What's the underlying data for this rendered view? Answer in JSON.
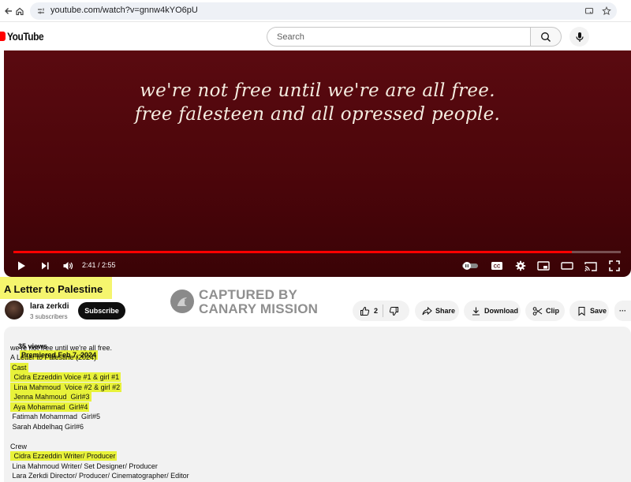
{
  "browser": {
    "url": "youtube.com/watch?v=gnnw4kYO6pU"
  },
  "header": {
    "logo_text": "YouTube",
    "search_placeholder": "Search"
  },
  "player": {
    "caption_line1": "we're not free until we're are all free.",
    "caption_line2": "free falesteen and all opressed people.",
    "time_current": "2:41",
    "time_separator": " / ",
    "time_total": "2:55",
    "progress_fraction": 0.92
  },
  "video": {
    "title": "A Letter to Palestine",
    "channel_name": "lara zerkdi",
    "subscriber_count": "3 subscribers",
    "subscribe_label": "Subscribe",
    "like_count": "2",
    "share_label": "Share",
    "download_label": "Download",
    "clip_label": "Clip",
    "save_label": "Save",
    "more_label": "···"
  },
  "watermark": {
    "line1": "CAPTURED BY",
    "line2": "CANARY MISSION"
  },
  "description": {
    "views": "35 views",
    "premiered": "Premiered Feb 7, 2024",
    "lines": [
      "we're not free until we're all free.",
      "A Letter to Palestine (2024)",
      "Cast",
      " Cidra Ezzeddin Voice #1 & girl #1",
      " Lina Mahmoud  Voice #2 & girl #2",
      " Jenna Mahmoud  Girl#3",
      " Aya Mohammad  Girl#4",
      " Fatimah Mohammad  Girl#5",
      " Sarah Abdelhaq Girl#6",
      "",
      "Crew",
      " Cidra Ezzeddin Writer/ Producer",
      " Lina Mahmoud Writer/ Set Designer/ Producer",
      " Lara Zerkdi Director/ Producer/ Cinematographer/ Editor"
    ]
  },
  "colors": {
    "highlight": "#e8f23a",
    "title_highlight": "#f5f56e",
    "youtube_red": "#ff0000",
    "player_bg": "#4a050a"
  },
  "icons": [
    "back-icon",
    "home-icon",
    "site-info-icon",
    "cast-to-device-icon",
    "bookmark-star-icon",
    "search-icon",
    "mic-icon",
    "play-icon",
    "next-icon",
    "volume-icon",
    "autoplay-toggle-icon",
    "captions-icon",
    "settings-gear-icon",
    "miniplayer-icon",
    "theater-icon",
    "cast-icon",
    "fullscreen-icon",
    "like-icon",
    "dislike-icon",
    "share-icon",
    "download-icon",
    "clip-icon",
    "save-icon"
  ]
}
